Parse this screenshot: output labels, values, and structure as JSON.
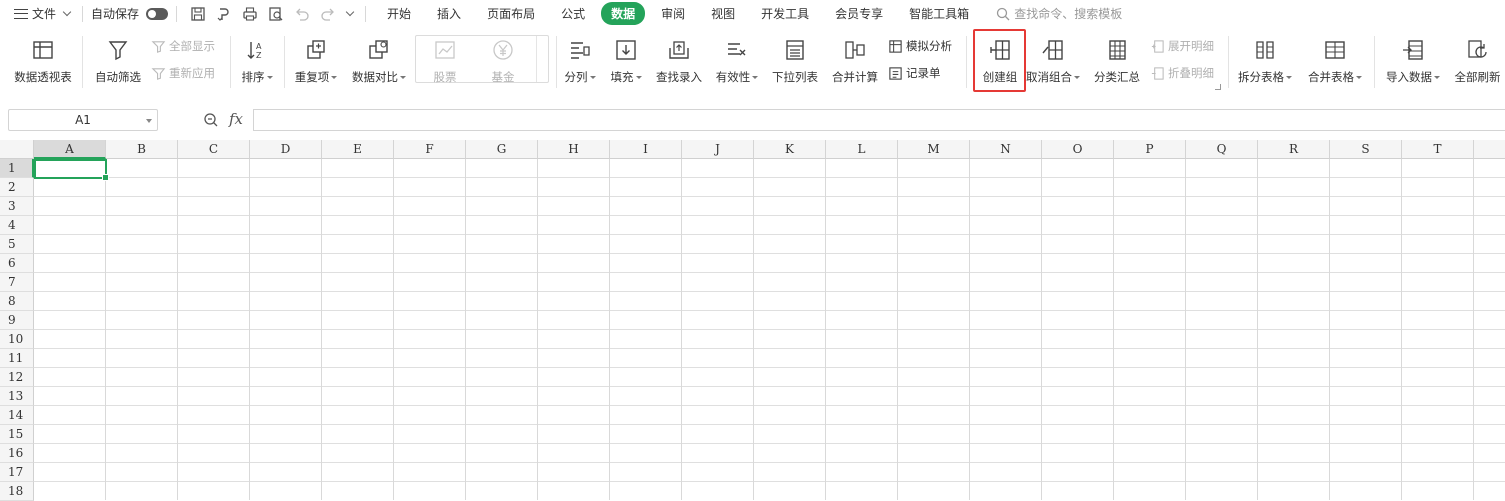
{
  "menubar": {
    "file_label": "文件",
    "autosave_label": "自动保存",
    "tabs": [
      "开始",
      "插入",
      "页面布局",
      "公式",
      "数据",
      "审阅",
      "视图",
      "开发工具",
      "会员专享",
      "智能工具箱"
    ],
    "active_tab": "数据",
    "search_placeholder": "查找命令、搜索模板"
  },
  "ribbon": {
    "pivot": "数据透视表",
    "autofilter": "自动筛选",
    "show_all": "全部显示",
    "reapply": "重新应用",
    "sort": "排序",
    "duplicates": "重复项",
    "compare": "数据对比",
    "stock": "股票",
    "fund": "基金",
    "split_col": "分列",
    "fill": "填充",
    "lookup_entry": "查找录入",
    "validity": "有效性",
    "dropdown_list": "下拉列表",
    "consolidate": "合并计算",
    "what_if": "模拟分析",
    "record_form": "记录单",
    "create_group": "创建组",
    "ungroup": "取消组合",
    "subtotal": "分类汇总",
    "expand_detail": "展开明细",
    "collapse_detail": "折叠明细",
    "split_table": "拆分表格",
    "merge_table": "合并表格",
    "import_data": "导入数据",
    "refresh_all": "全部刷新"
  },
  "formula_bar": {
    "cell_ref": "A1",
    "fx": "fx",
    "value": ""
  },
  "sheet": {
    "columns": [
      "A",
      "B",
      "C",
      "D",
      "E",
      "F",
      "G",
      "H",
      "I",
      "J",
      "K",
      "L",
      "M",
      "N",
      "O",
      "P",
      "Q",
      "R",
      "S",
      "T"
    ],
    "rows": [
      "1",
      "2",
      "3",
      "4",
      "5",
      "6",
      "7",
      "8",
      "9",
      "10",
      "11",
      "12",
      "13",
      "14",
      "15",
      "16",
      "17",
      "18"
    ],
    "selected_cell": "A1"
  },
  "colors": {
    "accent_green": "#24a35a",
    "highlight_red": "#e53935"
  }
}
